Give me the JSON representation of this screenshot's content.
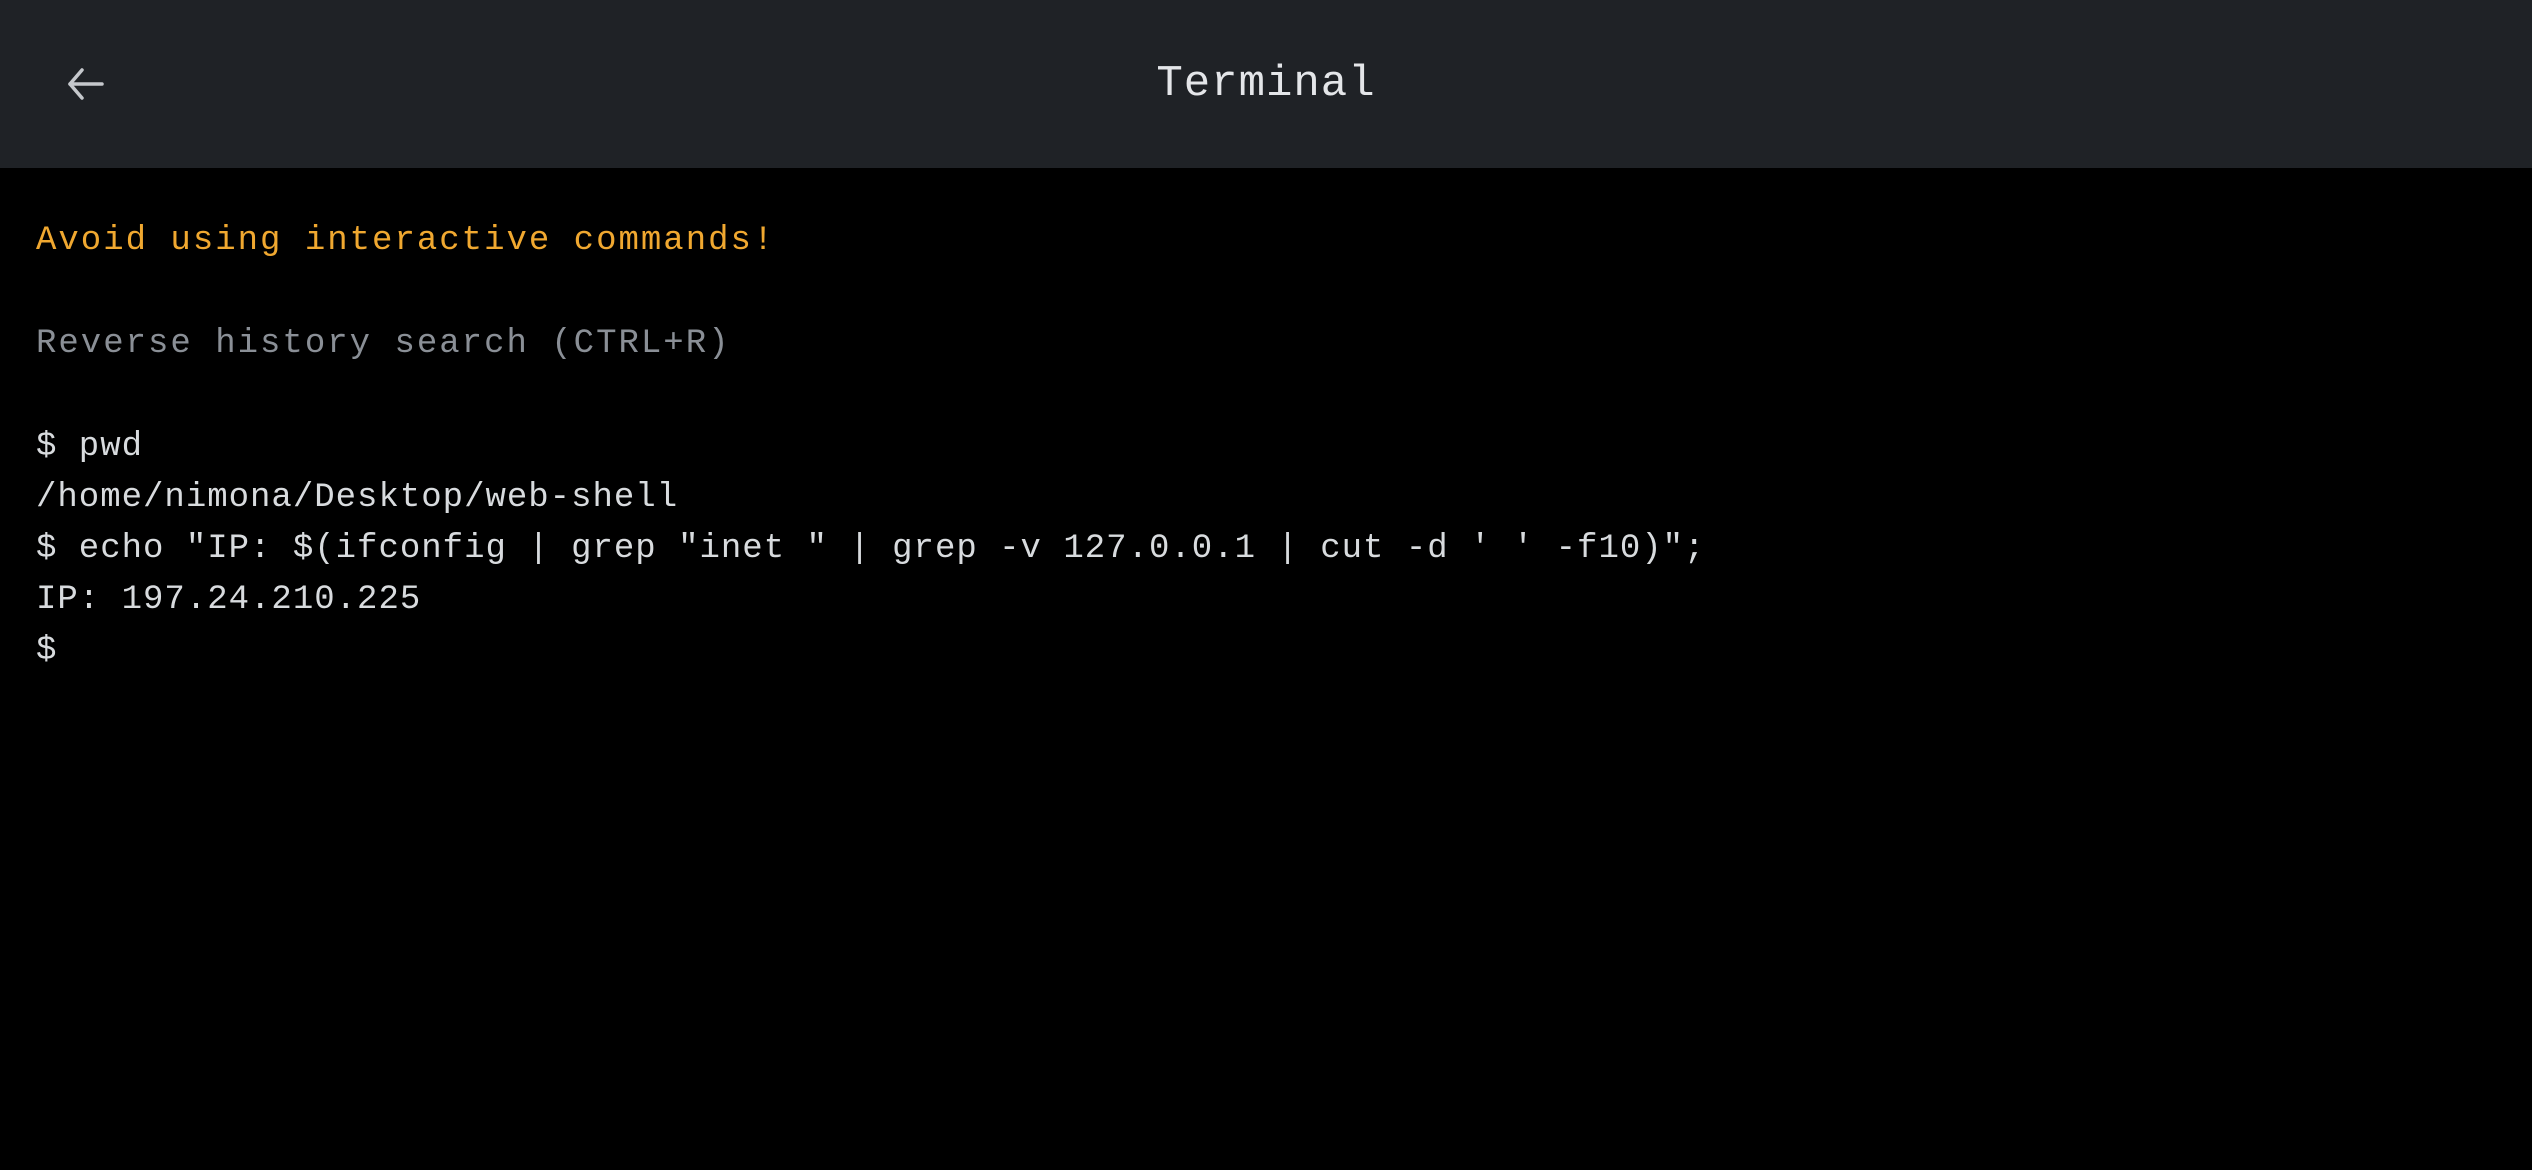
{
  "header": {
    "title": "Terminal"
  },
  "terminal": {
    "warning": "Avoid using interactive commands!",
    "search_hint": "Reverse history search (CTRL+R)",
    "prompt_symbol": "$",
    "history": [
      {
        "type": "cmd",
        "text": "$ pwd"
      },
      {
        "type": "out",
        "text": "/home/nimona/Desktop/web-shell"
      },
      {
        "type": "cmd",
        "text": "$ echo \"IP: $(ifconfig | grep \"inet \" | grep -v 127.0.0.1 | cut -d ' ' -f10)\";"
      },
      {
        "type": "out",
        "text": "IP: 197.24.210.225"
      }
    ],
    "current_input": ""
  },
  "colors": {
    "header_bg": "#1f2226",
    "body_bg": "#000000",
    "warning": "#f0a830",
    "hint": "#8a8f96",
    "text": "#d8dbde"
  }
}
